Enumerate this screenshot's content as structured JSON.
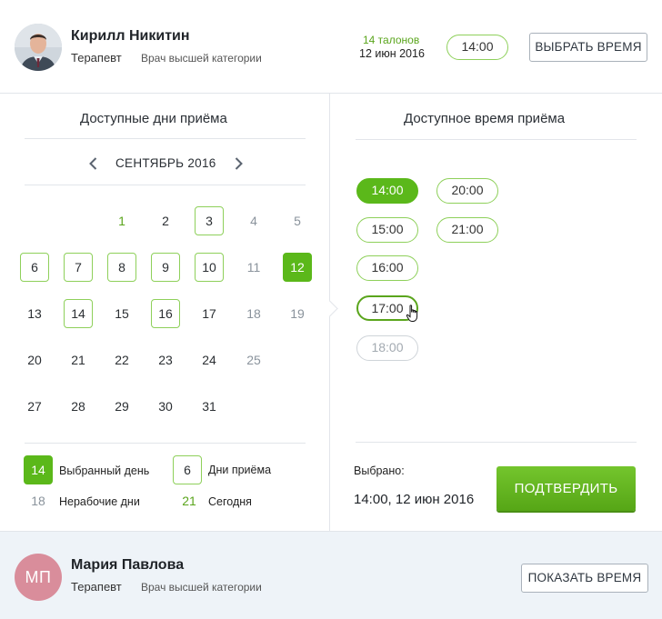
{
  "doctor1": {
    "name": "Кирилл Никитин",
    "role": "Терапевт",
    "grade": "Врач высшей категории",
    "tickets": "14 талонов",
    "date": "12 июн 2016",
    "time": "14:00",
    "choose_button": "ВЫБРАТЬ ВРЕМЯ"
  },
  "calendar": {
    "title": "Доступные дни приёма",
    "month": "СЕНТЯБРЬ 2016",
    "weeks": [
      [
        null,
        {
          "d": "1",
          "s": "today"
        },
        {
          "d": "2",
          "s": "normal"
        },
        {
          "d": "3",
          "s": "avail"
        },
        {
          "d": "4",
          "s": "off"
        },
        {
          "d": "5",
          "s": "off"
        }
      ],
      [
        {
          "d": "6",
          "s": "avail"
        },
        {
          "d": "7",
          "s": "avail"
        },
        {
          "d": "8",
          "s": "avail"
        },
        {
          "d": "9",
          "s": "avail"
        },
        {
          "d": "10",
          "s": "avail"
        },
        {
          "d": "11",
          "s": "off"
        },
        {
          "d": "12",
          "s": "selected"
        }
      ],
      [
        {
          "d": "13",
          "s": "normal"
        },
        {
          "d": "14",
          "s": "avail"
        },
        {
          "d": "15",
          "s": "normal"
        },
        {
          "d": "16",
          "s": "avail"
        },
        {
          "d": "17",
          "s": "normal"
        },
        {
          "d": "18",
          "s": "off"
        },
        {
          "d": "19",
          "s": "off"
        }
      ],
      [
        {
          "d": "20",
          "s": "normal"
        },
        {
          "d": "21",
          "s": "normal"
        },
        {
          "d": "22",
          "s": "normal"
        },
        {
          "d": "23",
          "s": "normal"
        },
        {
          "d": "24",
          "s": "normal"
        },
        {
          "d": "25",
          "s": "off"
        }
      ],
      [
        {
          "d": "27",
          "s": "normal"
        },
        {
          "d": "28",
          "s": "normal"
        },
        {
          "d": "29",
          "s": "normal"
        },
        {
          "d": "30",
          "s": "normal"
        },
        {
          "d": "31",
          "s": "normal"
        }
      ]
    ],
    "first_week_offset": 1
  },
  "legend": {
    "selected_num": "14",
    "selected_label": "Выбранный день",
    "avail_num": "6",
    "avail_label": "Дни приёма",
    "off_num": "18",
    "off_label": "Нерабочие дни",
    "today_num": "21",
    "today_label": "Сегодня"
  },
  "times": {
    "title": "Доступное время приёма",
    "slots": [
      {
        "t": "14:00",
        "s": "active"
      },
      {
        "t": "20:00",
        "s": "normal"
      },
      {
        "t": "15:00",
        "s": "normal"
      },
      {
        "t": "21:00",
        "s": "normal"
      },
      {
        "t": "16:00",
        "s": "normal"
      },
      {
        "t": "17:00",
        "s": "hover"
      },
      {
        "t": "18:00",
        "s": "disabled"
      }
    ]
  },
  "selection": {
    "label": "Выбрано:",
    "value": "14:00, 12 июн 2016",
    "confirm_button": "ПОДТВЕРДИТЬ"
  },
  "doctor2": {
    "initials": "МП",
    "name": "Мария Павлова",
    "role": "Терапевт",
    "grade": "Врач высшей категории",
    "show_button": "ПОКАЗАТЬ ВРЕМЯ"
  },
  "colors": {
    "accent": "#5bb81a",
    "available_border": "#8ed05a",
    "today_text": "#5aa51c",
    "off_text": "#8a939c",
    "avatar_bg": "#d98d9b",
    "bottom_card_bg": "#eef3f8"
  },
  "icons": {
    "prev": "chevron-left-icon",
    "next": "chevron-right-icon",
    "cursor": "hand-pointer-icon"
  }
}
